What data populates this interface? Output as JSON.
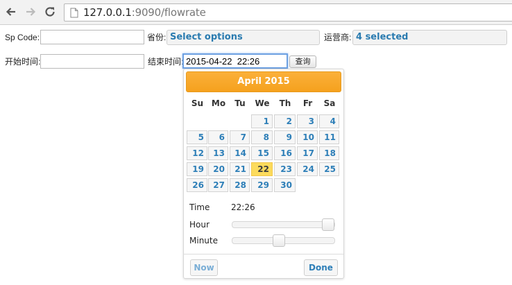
{
  "browser": {
    "url_host": "127.0.0.1",
    "url_path": ":9090/flowrate"
  },
  "form": {
    "sp_code_label": "Sp Code:",
    "sp_code_value": "",
    "province_label": "省份:",
    "province_value": "Select options",
    "carrier_label": "运营商:",
    "carrier_value": "4 selected",
    "start_label": "开始时间:",
    "start_value": "",
    "end_label": "结束时间:",
    "end_value": "2015-04-22  22:26",
    "query_label": "查询"
  },
  "datepicker": {
    "month_title": "April 2015",
    "weekdays": [
      "Su",
      "Mo",
      "Tu",
      "We",
      "Th",
      "Fr",
      "Sa"
    ],
    "days": [
      "1",
      "2",
      "3",
      "4",
      "5",
      "6",
      "7",
      "8",
      "9",
      "10",
      "11",
      "12",
      "13",
      "14",
      "15",
      "16",
      "17",
      "18",
      "19",
      "20",
      "21",
      "22",
      "23",
      "24",
      "25",
      "26",
      "27",
      "28",
      "29",
      "30"
    ],
    "selected_day": "22",
    "time_label": "Time",
    "time_value": "22:26",
    "hour_label": "Hour",
    "minute_label": "Minute",
    "hour_level": 1.0,
    "minute_level": 0.44,
    "now_label": "Now",
    "done_label": "Done"
  },
  "colors": {
    "header_orange": "#f5a11e",
    "link_blue": "#2e7fb8",
    "today_yellow": "#fcdb5c"
  }
}
